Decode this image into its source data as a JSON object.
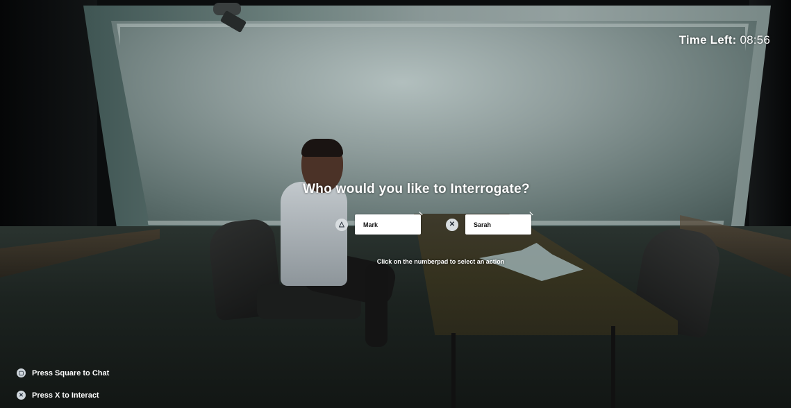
{
  "hud": {
    "timer_label": "Time Left:",
    "timer_value": "08:56"
  },
  "dialog": {
    "prompt": "Who would you like to Interrogate?",
    "hint": "Click on the numberpad to select an action",
    "options": [
      {
        "button_icon": "triangle-button-icon",
        "glyph": "△",
        "label": "Mark"
      },
      {
        "button_icon": "cross-button-icon",
        "glyph": "✕",
        "label": "Sarah"
      }
    ]
  },
  "controls": [
    {
      "icon": "square-button-icon",
      "glyph": "▢",
      "label": "Press Square to Chat"
    },
    {
      "icon": "cross-button-icon",
      "glyph": "✕",
      "label": "Press X to Interact"
    }
  ],
  "colors": {
    "hud_text": "#ffffff",
    "button_icon_bg": "#d8dde0",
    "card_bg": "#ffffff"
  }
}
